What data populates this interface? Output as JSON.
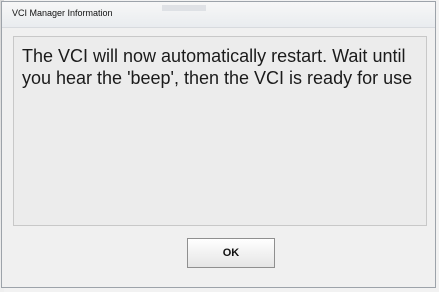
{
  "window": {
    "title": "VCI Manager Information"
  },
  "message": {
    "text": "The VCI will now automatically restart. Wait until you hear the 'beep', then the VCI is ready for use"
  },
  "buttons": {
    "ok_label": "OK"
  }
}
